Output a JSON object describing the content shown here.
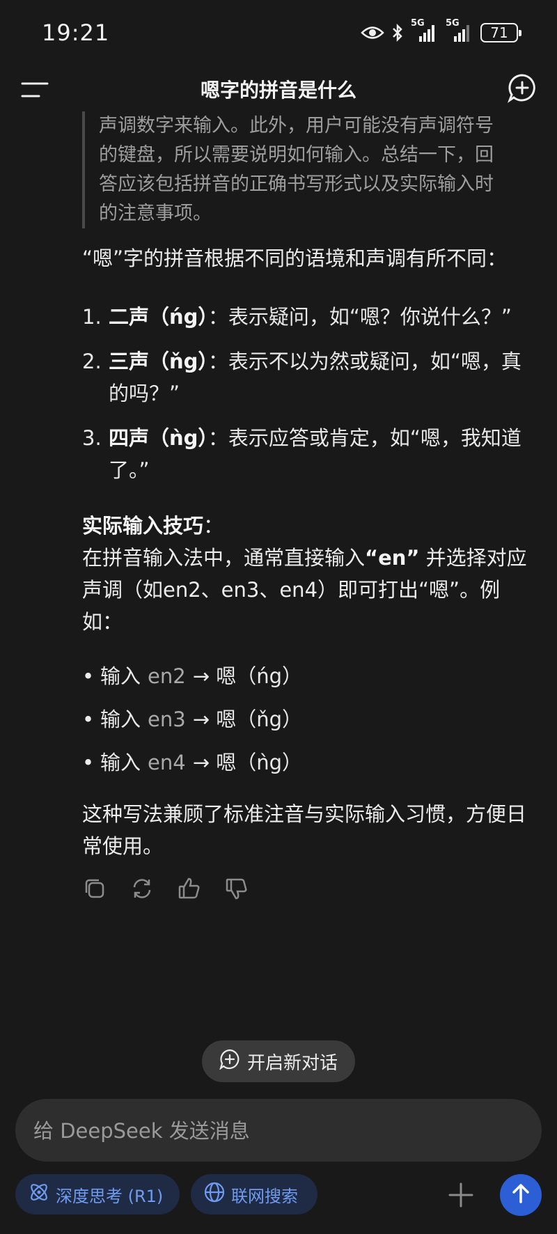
{
  "status": {
    "time": "19:21",
    "battery": "71",
    "net1": "5G",
    "net2": "5G"
  },
  "header": {
    "title": "嗯字的拼音是什么"
  },
  "thinking": {
    "lines": [
      "声调数字来输入。此外，用户可能没有声调符号",
      "的键盘，所以需要说明如何输入。总结一下，回",
      "答应该包括拼音的正确书写形式以及实际输入时",
      "的注意事项。"
    ]
  },
  "answer": {
    "intro": "“嗯”字的拼音根据不同的语境和声调有所不同：",
    "tones": [
      {
        "num": "1.",
        "label": "二声（ńg）",
        "desc": "：表示疑问，如“嗯？你说什么？”"
      },
      {
        "num": "2.",
        "label": "三声（ňg）",
        "desc": "：表示不以为然或疑问，如“嗯，真的吗？”"
      },
      {
        "num": "3.",
        "label": "四声（ǹg）",
        "desc": "：表示应答或肯定，如“嗯，我知道了。”"
      }
    ],
    "tips_title": "实际输入技巧",
    "tips_colon": "：",
    "tips_pre": "在拼音输入法中，通常直接输入",
    "tips_en": "“en”",
    "tips_post": " 并选择对应声调（如en2、en3、en4）即可打出“嗯”。例如：",
    "examples": [
      {
        "prefix": "输入",
        "code": "en2",
        "result": "→ 嗯（ńg）"
      },
      {
        "prefix": "输入",
        "code": "en3",
        "result": "→ 嗯（ňg）"
      },
      {
        "prefix": "输入",
        "code": "en4",
        "result": "→ 嗯（ǹg）"
      }
    ],
    "closing": "这种写法兼顾了标准注音与实际输入习惯，方便日常使用。"
  },
  "new_chat": {
    "label": "开启新对话"
  },
  "input": {
    "placeholder": "给 DeepSeek 发送消息"
  },
  "toolbar": {
    "deep_think": "深度思考 (R1)",
    "web_search": "联网搜索"
  },
  "colors": {
    "accent": "#2c5fd6",
    "chip_text": "#6f9bf0",
    "background": "#191919"
  }
}
